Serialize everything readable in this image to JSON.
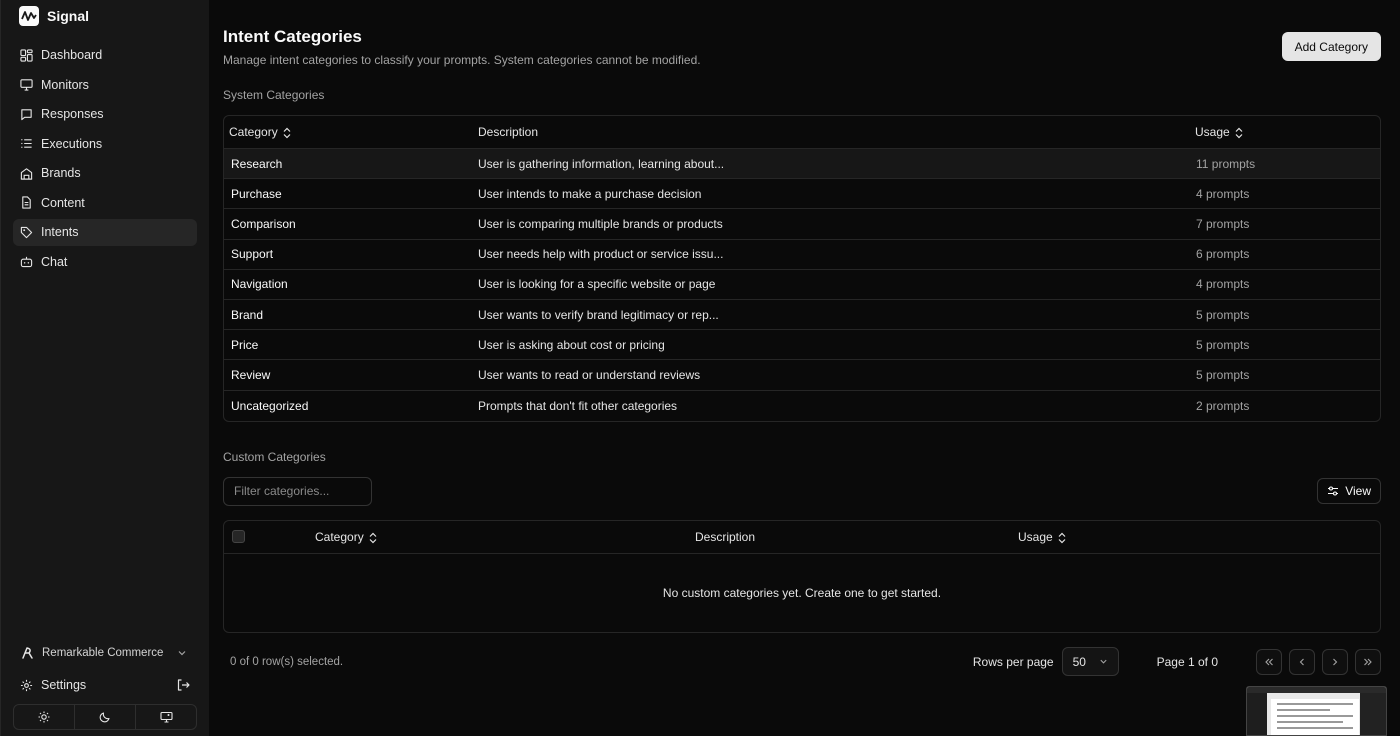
{
  "app": {
    "name": "Signal"
  },
  "sidebar": {
    "items": [
      {
        "label": "Dashboard",
        "icon": "dashboard-icon"
      },
      {
        "label": "Monitors",
        "icon": "monitor-icon"
      },
      {
        "label": "Responses",
        "icon": "message-icon"
      },
      {
        "label": "Executions",
        "icon": "list-icon"
      },
      {
        "label": "Brands",
        "icon": "building-icon"
      },
      {
        "label": "Content",
        "icon": "file-icon"
      },
      {
        "label": "Intents",
        "icon": "tag-icon",
        "active": true
      },
      {
        "label": "Chat",
        "icon": "bot-icon"
      }
    ],
    "org": "Remarkable Commerce",
    "settings": "Settings"
  },
  "header": {
    "title": "Intent Categories",
    "subtitle": "Manage intent categories to classify your prompts. System categories cannot be modified.",
    "add_button": "Add Category"
  },
  "system": {
    "label": "System Categories",
    "columns": {
      "category": "Category",
      "description": "Description",
      "usage": "Usage"
    },
    "rows": [
      {
        "category": "Research",
        "description": "User is gathering information, learning about...",
        "usage": "11 prompts"
      },
      {
        "category": "Purchase",
        "description": "User intends to make a purchase decision",
        "usage": "4 prompts"
      },
      {
        "category": "Comparison",
        "description": "User is comparing multiple brands or products",
        "usage": "7 prompts"
      },
      {
        "category": "Support",
        "description": "User needs help with product or service issu...",
        "usage": "6 prompts"
      },
      {
        "category": "Navigation",
        "description": "User is looking for a specific website or page",
        "usage": "4 prompts"
      },
      {
        "category": "Brand",
        "description": "User wants to verify brand legitimacy or rep...",
        "usage": "5 prompts"
      },
      {
        "category": "Price",
        "description": "User is asking about cost or pricing",
        "usage": "5 prompts"
      },
      {
        "category": "Review",
        "description": "User wants to read or understand reviews",
        "usage": "5 prompts"
      },
      {
        "category": "Uncategorized",
        "description": "Prompts that don't fit other categories",
        "usage": "2 prompts"
      }
    ]
  },
  "custom": {
    "label": "Custom Categories",
    "filter_placeholder": "Filter categories...",
    "view_button": "View",
    "columns": {
      "category": "Category",
      "description": "Description",
      "usage": "Usage"
    },
    "empty": "No custom categories yet. Create one to get started."
  },
  "footer": {
    "selected": "0 of 0 row(s) selected.",
    "rows_per_page_label": "Rows per page",
    "rows_per_page_value": "50",
    "page_info": "Page 1 of 0"
  }
}
